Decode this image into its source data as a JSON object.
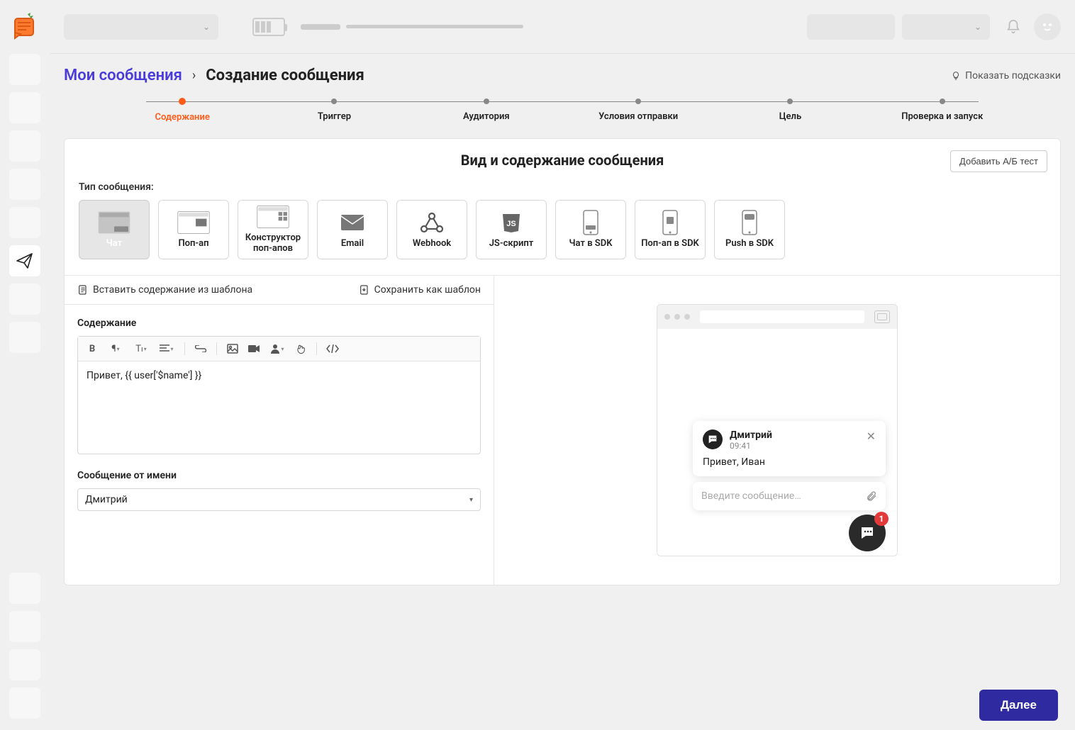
{
  "breadcrumb": {
    "parent": "Мои сообщения",
    "current": "Создание сообщения"
  },
  "hints_label": "Показать подсказки",
  "steps": [
    {
      "label": "Содержание",
      "active": true
    },
    {
      "label": "Триггер"
    },
    {
      "label": "Аудитория"
    },
    {
      "label": "Условия отправки"
    },
    {
      "label": "Цель"
    },
    {
      "label": "Проверка и запуск"
    }
  ],
  "card_title": "Вид и содержание сообщения",
  "ab_button": "Добавить А/Б тест",
  "type_label": "Тип сообщения:",
  "message_types": [
    {
      "label": "Чат",
      "active": true
    },
    {
      "label": "Поп-ап"
    },
    {
      "label": "Конструктор поп-апов"
    },
    {
      "label": "Email"
    },
    {
      "label": "Webhook"
    },
    {
      "label": "JS-скрипт"
    },
    {
      "label": "Чат в SDK"
    },
    {
      "label": "Поп-ап в SDK"
    },
    {
      "label": "Push в SDK"
    }
  ],
  "template_bar": {
    "insert": "Вставить содержание из шаблона",
    "save": "Сохранить как шаблон"
  },
  "content": {
    "label": "Содержание",
    "value": "Привет, {{ user['$name'] }}"
  },
  "sender": {
    "label": "Сообщение от имени",
    "value": "Дмитрий"
  },
  "preview": {
    "sender_name": "Дмитрий",
    "time": "09:41",
    "message": "Привет, Иван",
    "input_placeholder": "Введите сообщение…",
    "badge": "1"
  },
  "footer": {
    "next": "Далее"
  }
}
